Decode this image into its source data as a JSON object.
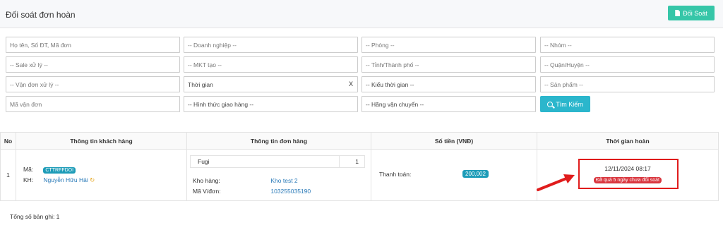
{
  "header": {
    "title": "Đối soát đơn hoàn",
    "doisoat_label": "Đối Soát"
  },
  "filters": {
    "row1": [
      "Họ tên, Số ĐT, Mã đơn",
      "-- Doanh nghiệp --",
      "-- Phòng --",
      "-- Nhóm --"
    ],
    "row2": [
      "-- Sale xử lý --",
      "-- MKT tạo --",
      "-- Tỉnh/Thành phố --",
      "-- Quận/Huyện --"
    ],
    "row3": [
      "-- Vận đơn xử lý --",
      "Thời gian",
      "-- Kiểu thời gian --",
      "-- Sản phẩm --"
    ],
    "row4": [
      "Mã vận đơn",
      "-- Hình thức giao hàng --",
      "-- Hãng vận chuyển --"
    ],
    "clear": "X",
    "search_label": "Tìm Kiếm"
  },
  "table": {
    "headers": [
      "No",
      "Thông tin khách hàng",
      "Thông tin đơn hàng",
      "Số tiền (VNĐ)",
      "Thời gian hoàn"
    ],
    "row": {
      "no": "1",
      "ma_label": "Mã:",
      "ma_value": "CTTRFFDOI",
      "kh_label": "KH:",
      "kh_value": "Nguyễn Hữu Hải",
      "product": "Fugi",
      "qty": "1",
      "kho_label": "Kho hàng:",
      "kho_value": "Kho test 2",
      "mavd_label": "Mã V/đơn:",
      "mavd_value": "103255035190",
      "tt_label": "Thanh toán:",
      "tt_value": "200,002",
      "time": "12/11/2024 08:17",
      "warn": "Đã quá 5 ngày chưa đối soát"
    }
  },
  "footer": {
    "total": "Tổng số bản ghi: 1"
  },
  "colors": {
    "accent": "#36c6a8",
    "search": "#2bb6cc",
    "warn": "#d9363e",
    "highlight": "#e01c1c"
  }
}
